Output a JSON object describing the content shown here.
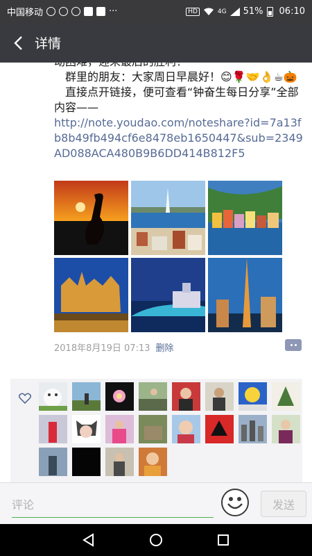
{
  "status_bar": {
    "carrier": "中国移动",
    "signal_label": "4G",
    "battery": "51%",
    "time": "06:10",
    "hd": "HD"
  },
  "nav": {
    "title": "详情"
  },
  "post": {
    "line0": "动困难，迎来最后的胜利！",
    "line1": "群里的朋友：大家周日早晨好！😊🌹🤝👌☕🎃",
    "line2": "直接点开链接，便可查看“钟奋生每日分享”全部内容——",
    "link": "http://note.youdao.com/noteshare?id=7a13fb8b49fb494cf6e8478eb1650447&sub=2349AD088ACA480B9B6DD414B812F5",
    "timestamp": "2018年8月19日 07:13",
    "delete_label": "删除"
  },
  "colors": {
    "link": "#576b95",
    "nav_bg": "#393a3f",
    "likes_bg": "#f3f3f5"
  },
  "comment_bar": {
    "placeholder": "评论",
    "send_label": "发送"
  }
}
